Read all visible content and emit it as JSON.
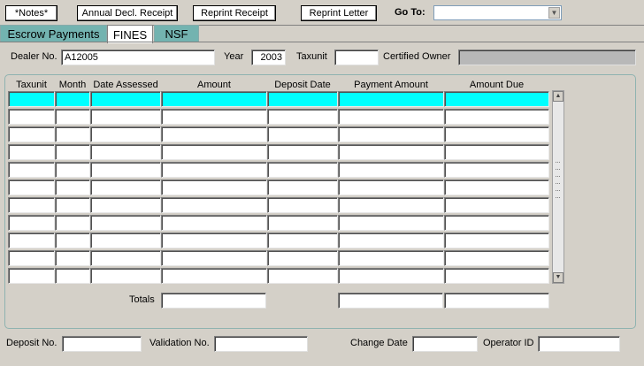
{
  "toolbar": {
    "notes_label": "*Notes*",
    "annual_decl_label": "Annual Decl. Receipt",
    "reprint_receipt_label": "Reprint Receipt",
    "reprint_letter_label": "Reprint Letter",
    "goto_label": "Go To:",
    "goto_value": ""
  },
  "tabs": [
    {
      "label": "Escrow Payments",
      "active": false
    },
    {
      "label": "FINES",
      "active": true
    },
    {
      "label": "NSF",
      "active": false
    }
  ],
  "header": {
    "dealer_no_label": "Dealer No.",
    "dealer_no_value": "A12005",
    "year_label": "Year",
    "year_value": "2003",
    "taxunit_label": "Taxunit",
    "taxunit_value": "",
    "certified_owner_label": "Certified Owner",
    "certified_owner_value": ""
  },
  "grid": {
    "columns": [
      "Taxunit",
      "Month",
      "Date Assessed",
      "Amount",
      "Deposit Date",
      "Payment Amount",
      "Amount Due"
    ],
    "rows": [
      [
        "",
        "",
        "",
        "",
        "",
        "",
        ""
      ],
      [
        "",
        "",
        "",
        "",
        "",
        "",
        ""
      ],
      [
        "",
        "",
        "",
        "",
        "",
        "",
        ""
      ],
      [
        "",
        "",
        "",
        "",
        "",
        "",
        ""
      ],
      [
        "",
        "",
        "",
        "",
        "",
        "",
        ""
      ],
      [
        "",
        "",
        "",
        "",
        "",
        "",
        ""
      ],
      [
        "",
        "",
        "",
        "",
        "",
        "",
        ""
      ],
      [
        "",
        "",
        "",
        "",
        "",
        "",
        ""
      ],
      [
        "",
        "",
        "",
        "",
        "",
        "",
        ""
      ],
      [
        "",
        "",
        "",
        "",
        "",
        "",
        ""
      ],
      [
        "",
        "",
        "",
        "",
        "",
        "",
        ""
      ]
    ],
    "current_row": 0
  },
  "totals": {
    "label": "Totals",
    "amount": "",
    "payment_amount": "",
    "amount_due": ""
  },
  "footer": {
    "deposit_no_label": "Deposit No.",
    "deposit_no_value": "",
    "validation_no_label": "Validation No.",
    "validation_no_value": "",
    "change_date_label": "Change Date",
    "change_date_value": "",
    "operator_id_label": "Operator ID",
    "operator_id_value": ""
  },
  "colors": {
    "window_bg": "#d4d0c8",
    "tab_bg": "#73b3b0",
    "current_row": "#00ffff"
  }
}
